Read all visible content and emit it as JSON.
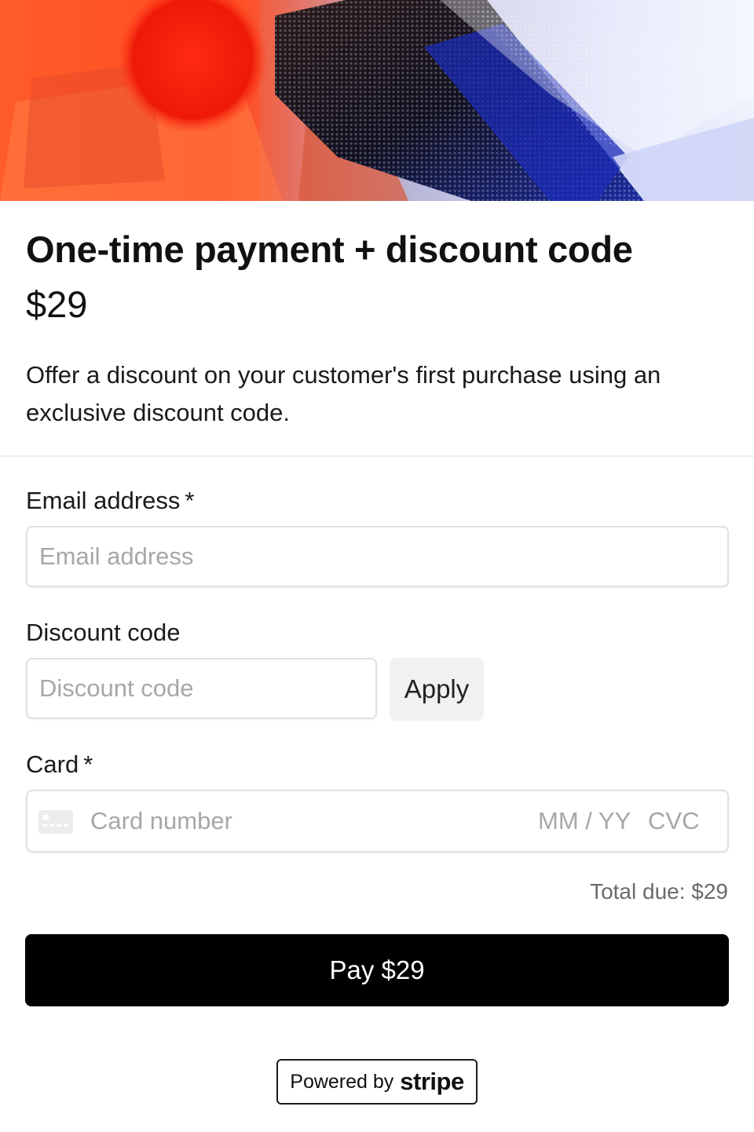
{
  "product": {
    "title": "One-time payment + discount code",
    "price": "$29",
    "description": "Offer a discount on your customer's first purchase using an exclusive discount code."
  },
  "form": {
    "email": {
      "label": "Email address",
      "required_mark": "*",
      "placeholder": "Email address"
    },
    "discount": {
      "label": "Discount code",
      "placeholder": "Discount code",
      "apply_label": "Apply"
    },
    "card": {
      "label": "Card",
      "required_mark": "*",
      "number_placeholder": "Card number",
      "expiry_placeholder": "MM / YY",
      "cvc_placeholder": "CVC",
      "icon": "generic-card-icon"
    },
    "total_due": "Total due: $29",
    "pay_label": "Pay $29"
  },
  "footer": {
    "powered_by": "Powered by",
    "brand": "stripe"
  },
  "colors": {
    "pay_button": "#000000",
    "apply_button": "#f2f0f1",
    "input_border": "#e0e0e0",
    "placeholder": "#a7a7a7"
  }
}
